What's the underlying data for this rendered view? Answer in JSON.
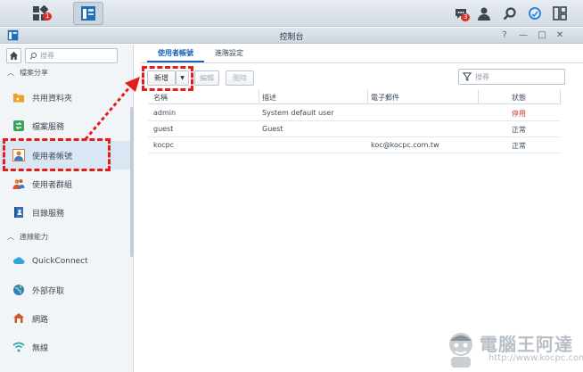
{
  "taskbar": {
    "main_menu_badge": "1",
    "notification_badge": "3"
  },
  "window": {
    "title": "控制台",
    "help": "?",
    "minimize": "—",
    "maximize": "□",
    "close": "✕"
  },
  "sidebar": {
    "search_placeholder": "搜尋",
    "sections": [
      {
        "label": "檔案分享"
      },
      {
        "label": "連線能力"
      }
    ],
    "items": [
      {
        "label": "共用資料夾",
        "icon": "shared-folder-icon"
      },
      {
        "label": "檔案服務",
        "icon": "file-services-icon"
      },
      {
        "label": "使用者帳號",
        "icon": "user-icon"
      },
      {
        "label": "使用者群組",
        "icon": "user-group-icon"
      },
      {
        "label": "目錄服務",
        "icon": "directory-icon"
      },
      {
        "label": "QuickConnect",
        "icon": "quickconnect-icon"
      },
      {
        "label": "外部存取",
        "icon": "globe-icon"
      },
      {
        "label": "網路",
        "icon": "network-icon"
      },
      {
        "label": "無線",
        "icon": "wifi-icon"
      }
    ]
  },
  "tabs": [
    {
      "label": "使用者帳號"
    },
    {
      "label": "進階設定"
    }
  ],
  "toolbar": {
    "create_label": "新增",
    "edit_label": "編輯",
    "delete_label": "刪除",
    "filter_placeholder": "搜尋"
  },
  "table": {
    "columns": [
      "名稱",
      "描述",
      "電子郵件",
      "狀態"
    ],
    "rows": [
      {
        "name": "admin",
        "description": "System default user",
        "email": "",
        "status": "停用"
      },
      {
        "name": "guest",
        "description": "Guest",
        "email": "",
        "status": "正常"
      },
      {
        "name": "kocpc",
        "description": "",
        "email": "koc@kocpc.com.tw",
        "status": "正常"
      }
    ]
  },
  "watermark": {
    "title": "電腦王阿達",
    "url": "http://www.kocpc.com.tw"
  },
  "colors": {
    "accent": "#1665b5",
    "status_disabled": "#d23b2f",
    "annotation": "#e81b1b"
  }
}
